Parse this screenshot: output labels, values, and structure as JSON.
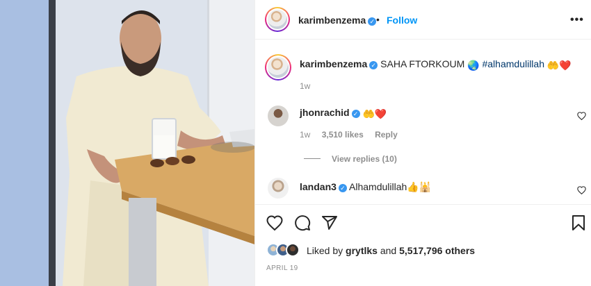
{
  "post": {
    "author": "karimbenzema",
    "follow_label": "Follow",
    "separator": "•",
    "more_label": "•••",
    "verified_mark": "✓"
  },
  "caption": {
    "username": "karimbenzema",
    "text": "SAHA FTORKOUM",
    "globe_emoji": "🌏",
    "hashtag": "#alhamdulillah",
    "trailing_emojis": "🤲❤️",
    "time": "1w"
  },
  "comments": [
    {
      "username": "jhonrachid",
      "text": "🤲❤️",
      "time": "1w",
      "likes": "3,510 likes",
      "reply_label": "Reply",
      "view_replies": "View replies (10)"
    },
    {
      "username": "landan3",
      "text": "Alhamdulillah👍🕌"
    }
  ],
  "likes": {
    "prefix": "Liked by ",
    "user": "grytlks",
    "middle": " and ",
    "count": "5,517,796 others"
  },
  "date": "APRIL 19",
  "icons": {
    "like": "heart-outline-icon",
    "comment": "comment-bubble-icon",
    "share": "paper-plane-icon",
    "save": "bookmark-icon",
    "more": "more-options-icon"
  },
  "colors": {
    "link_blue": "#0095f6",
    "hashtag": "#00376b",
    "muted": "#8e8e8e",
    "verified": "#3897f0",
    "heart_red": "#ed4956"
  }
}
